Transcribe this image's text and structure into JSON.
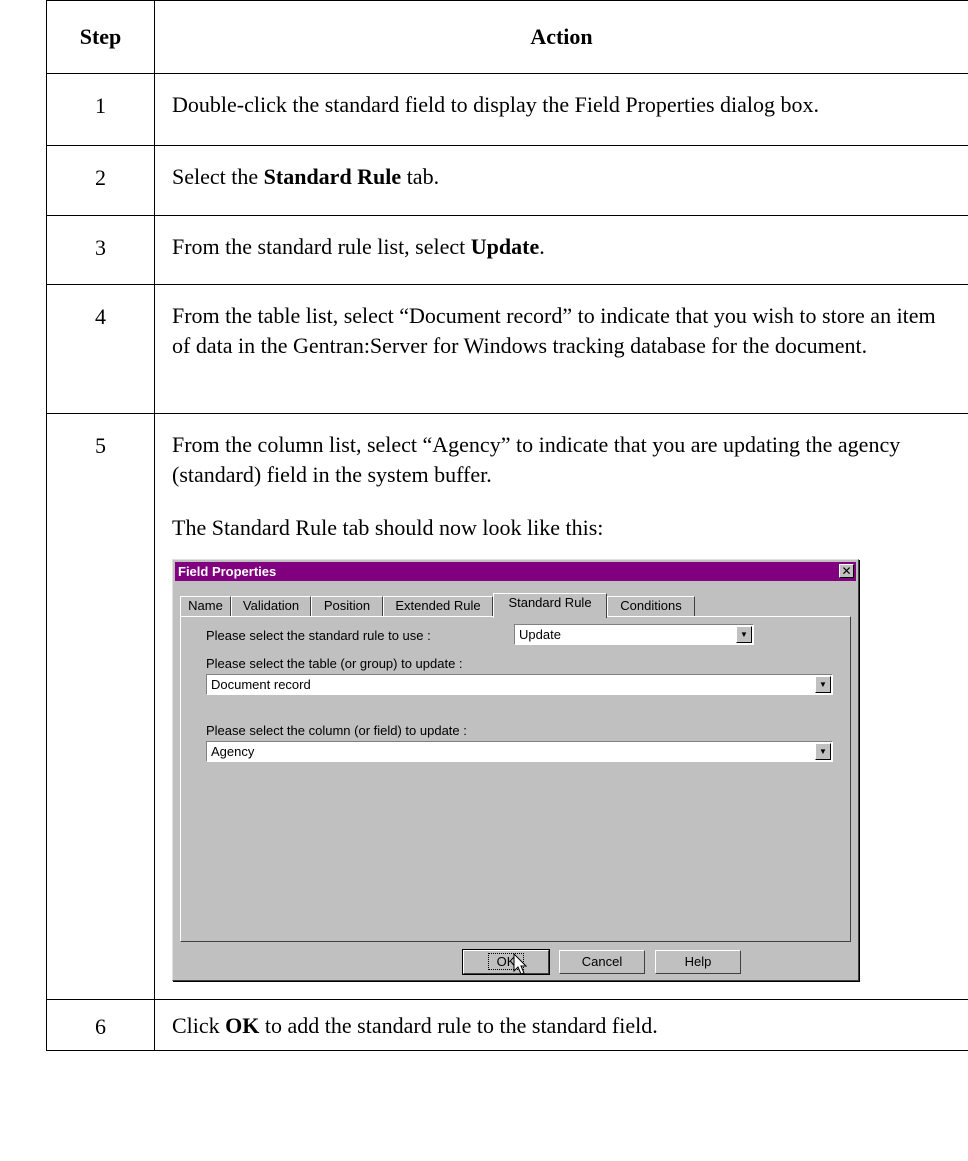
{
  "table": {
    "headers": {
      "step": "Step",
      "action": "Action"
    },
    "rows": [
      {
        "step": "1",
        "action": "Double-click the standard field to display the Field Properties dialog box."
      },
      {
        "step": "2",
        "pre": "Select the ",
        "bold": "Standard Rule",
        "post": " tab."
      },
      {
        "step": "3",
        "pre": "From the standard rule list, select ",
        "bold": "Update",
        "post": "."
      },
      {
        "step": "4",
        "action": "From the table list, select “Document record” to indicate that you wish to store an item of data in the Gentran:Server for Windows tracking database for the document."
      },
      {
        "step": "5",
        "action": "From the column list, select “Agency” to indicate that you are updating the agency (standard) field in the system buffer.",
        "action2": "The Standard Rule tab should now look like this:"
      },
      {
        "step": "6",
        "pre": "Click ",
        "bold": "OK",
        "post": " to add the standard rule to the standard field."
      }
    ]
  },
  "dialog": {
    "title": "Field Properties",
    "close_icon": "close-x-icon",
    "tabs": [
      "Name",
      "Validation",
      "Position",
      "Extended Rule",
      "Standard Rule",
      "Conditions"
    ],
    "active_tab": "Standard Rule",
    "rule_label": "Please select the standard rule to use :",
    "rule_value": "Update",
    "table_label": "Please select the table (or group) to update :",
    "table_value": "Document record",
    "column_label": "Please select the column (or field) to update :",
    "column_value": "Agency",
    "ok_label": "OK",
    "cancel_label": "Cancel",
    "help_label": "Help",
    "title_color": "#800080",
    "face_color": "#c0c0c0"
  }
}
